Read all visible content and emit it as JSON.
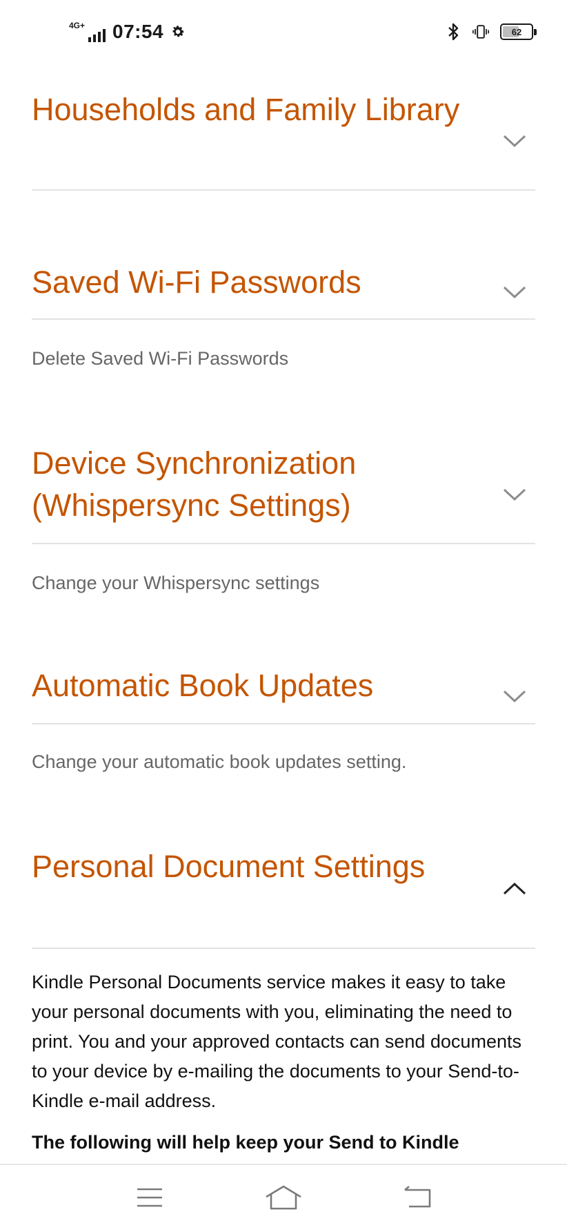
{
  "status_bar": {
    "network": "4G+",
    "time": "07:54",
    "battery": "62",
    "battery_level": 0.62
  },
  "sections": [
    {
      "title": "Households and Family Library",
      "expanded": false,
      "subtitle": ""
    },
    {
      "title": "Saved Wi-Fi Passwords",
      "expanded": false,
      "subtitle": "Delete Saved Wi-Fi Passwords"
    },
    {
      "title": "Device Synchronization (Whispersync Settings)",
      "expanded": false,
      "subtitle": "Change your Whispersync settings"
    },
    {
      "title": "Automatic Book Updates",
      "expanded": false,
      "subtitle": "Change your automatic book updates setting."
    },
    {
      "title": "Personal Document Settings",
      "expanded": true,
      "body": "Kindle Personal Documents service makes it easy to take your personal documents with you, eliminating the need to print. You and your approved contacts can send documents to your device by e-mailing the documents to your Send-to-Kindle e-mail address.",
      "bold_text": "The following will help keep your Send to Kindle"
    }
  ],
  "icons": {
    "settings": "gear-icon",
    "bluetooth": "bluetooth-icon",
    "vibrate": "vibrate-icon",
    "battery": "battery-icon",
    "collapsed": "chevron-down-icon",
    "expanded": "chevron-up-icon",
    "nav_menu": "menu-icon",
    "nav_home": "home-icon",
    "nav_back": "back-icon"
  },
  "colors": {
    "title": "#c45500",
    "subtitle": "#666666",
    "divider": "#e3e3e3"
  }
}
